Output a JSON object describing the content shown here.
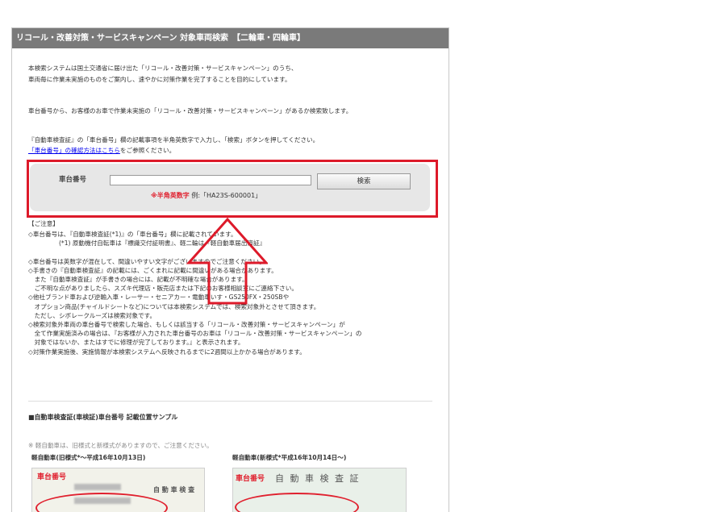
{
  "title": "リコール・改善対策・サービスキャンペーン 対象車両検索　【二輪車・四輪車】",
  "intro": {
    "line1": "本検索システムは国土交通省に届け出た「リコール・改善対策・サービスキャンペーン」のうち、",
    "line2": "車両毎に作業未実施のものをご案内し、速やかに対策作業を完了することを目的にしています。",
    "line3": "車台番号から、お客様のお車で作業未実施の「リコール・改善対策・サービスキャンペーン」があるか検索致します。",
    "line4": "『自動車検査証』の「車台番号」欄の記載事項を半角英数字で入力し、「検索」ボタンを押してください。",
    "link": "「車台番号」の確認方法はこちら",
    "link_suffix": "をご参照ください。"
  },
  "search": {
    "label": "車台番号",
    "input_value": "",
    "input_placeholder": "",
    "button": "検索",
    "hint_red": "※半角英数字",
    "hint_example": "例:「HA23S-600001」"
  },
  "notes": {
    "header": "【ご注意】",
    "lines": [
      "◇車台番号は、『自動車検査証(*1)』の「車台番号」欄に記載されています。",
      "　　　　　(*1) 原動機付自転車は『標識交付証明書』、軽二輪は『軽自動車届出済証』",
      "",
      "◇車台番号は英数字が混在して、間違いやすい文字がございますのでご注意ください。",
      "◇手書きの『自動車検査証』の記載には、ごくまれに記載に間違いがある場合があります。",
      "　また『自動車検査証』が手書きの場合には、記載が不明確な場合があります。",
      "　ご不明な点がありましたら、スズキ代理店・販売店または下記のお客様相談室にご連絡下さい。",
      "◇他社ブランド車および逆輸入車・レーサー・セニアカー・電動車いす・GS250FX・250SBや",
      "　オプション商品(チャイルドシートなど)については本検索システムでは、検索対象外とさせて頂きます。",
      "　ただし、シボレークルーズは検索対象です。",
      "◇検索対象外車両の車台番号で検索した場合、もしくは該当する「リコール・改善対策・サービスキャンペーン」が",
      "　全て作業実施済みの場合は、『お客様が入力された車台番号のお車は「リコール・改善対策・サービスキャンペーン」の",
      "　対象ではないか、またはすでに修理が完了しております。』と表示されます。",
      "◇対策作業実施後、実施情報が本検索システムへ反映されるまでに2週間以上かかる場合があります。"
    ]
  },
  "sample": {
    "heading": "■自動車検査証(車検証)車台番号 記載位置サンプル",
    "note": "※ 軽自動車は、旧様式と新様式がありますので、ご注意ください。",
    "old_caption": "軽自動車(旧様式*～平成16年10月13日)",
    "new_caption": "軽自動車(新様式*平成16年10月14日～)",
    "img_label": "車台番号",
    "old_cert_title": "自 動 車 検 査",
    "new_cert_title": "自 動 車 検 査 証"
  },
  "colors": {
    "title_bg": "#7a7a7a",
    "highlight": "#dd1a2a",
    "search_bg": "#e7e7e7"
  }
}
